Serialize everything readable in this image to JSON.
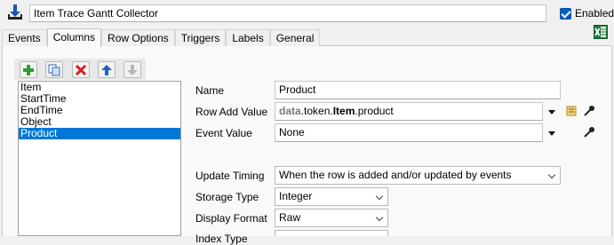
{
  "header": {
    "title": "Item Trace Gantt Collector",
    "enabled_label": "Enabled",
    "enabled_checked": true
  },
  "tabs": [
    {
      "label": "Events",
      "active": false
    },
    {
      "label": "Columns",
      "active": true
    },
    {
      "label": "Row Options",
      "active": false
    },
    {
      "label": "Triggers",
      "active": false
    },
    {
      "label": "Labels",
      "active": false
    },
    {
      "label": "General",
      "active": false
    }
  ],
  "toolbar": {
    "buttons": [
      {
        "name": "add-icon",
        "color": "#2e9e2e"
      },
      {
        "name": "duplicate-icon",
        "color": "#3a6fb8"
      },
      {
        "name": "delete-icon",
        "color": "#d42020"
      },
      {
        "name": "move-up-icon",
        "color": "#1f62c8"
      },
      {
        "name": "move-down-icon",
        "color": "#a8a8a8"
      }
    ]
  },
  "columns_list": {
    "items": [
      "Item",
      "StartTime",
      "EndTime",
      "Object",
      "Product"
    ],
    "selected_index": 4
  },
  "form": {
    "name_label": "Name",
    "name_value": "Product",
    "row_add_label": "Row Add Value",
    "row_add_value": {
      "part1": "data",
      "part2": ".token.",
      "part3": "Item",
      "part4": ".product"
    },
    "event_value_label": "Event Value",
    "event_value": "None",
    "update_timing_label": "Update Timing",
    "update_timing_value": "When the row is added and/or updated by events",
    "storage_type_label": "Storage Type",
    "storage_type_value": "Integer",
    "display_format_label": "Display Format",
    "display_format_value": "Raw",
    "index_type_label": "Index Type"
  },
  "colors": {
    "selection": "#0078d7",
    "panel_bg": "#f9f9f9",
    "window_bg": "#f0f0f0"
  }
}
